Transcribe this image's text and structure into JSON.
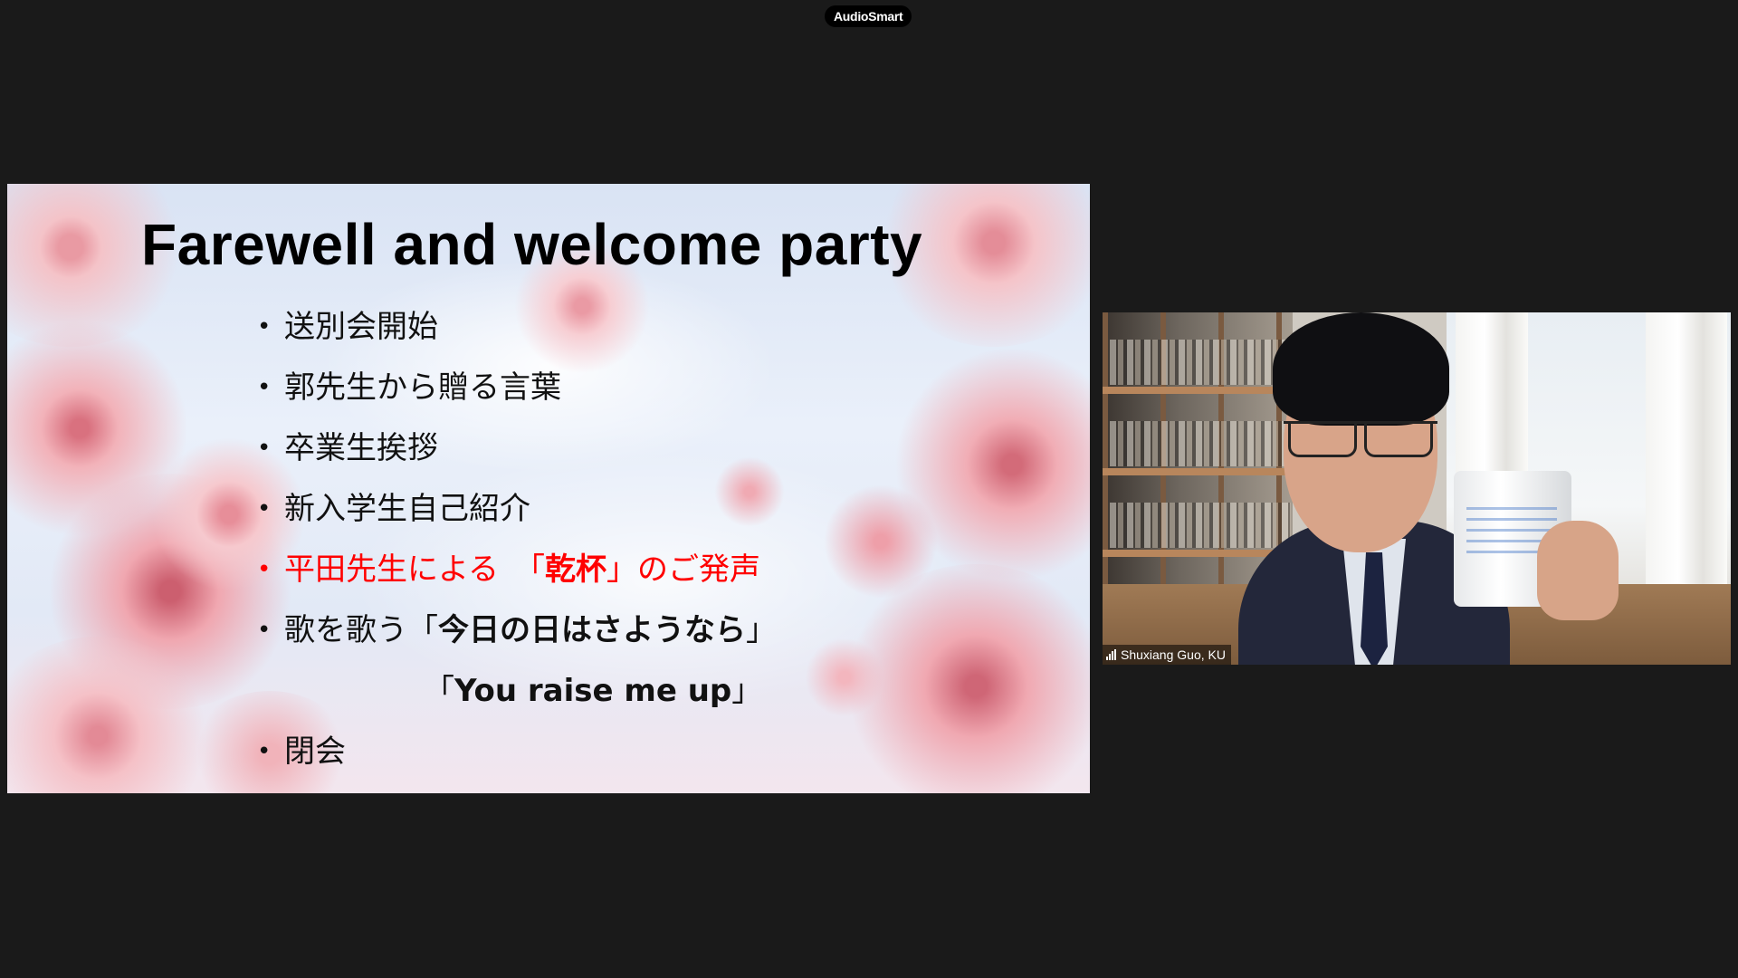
{
  "app": {
    "top_pill_label": "AudioSmart"
  },
  "slide": {
    "title": "Farewell and welcome party",
    "bullet_glyph": "•",
    "items": [
      {
        "text": "送別会開始"
      },
      {
        "text": "郭先生から贈る言葉"
      },
      {
        "text": "卒業生挨拶"
      },
      {
        "text": "新入学生自己紹介"
      },
      {
        "pre": "平田先生による　「",
        "bold": "乾杯",
        "post": "」のご発声"
      },
      {
        "pre": "歌を歌う「",
        "bold": "今日の日はさようなら",
        "post": "」"
      },
      {
        "pre": "「",
        "bold": "You raise me up",
        "post": "」"
      },
      {
        "text": "閉会"
      }
    ],
    "highlight_color": "#ff0000"
  },
  "participant": {
    "name": "Shuxiang Guo, KU",
    "connection_icon": "signal-bars-icon"
  }
}
